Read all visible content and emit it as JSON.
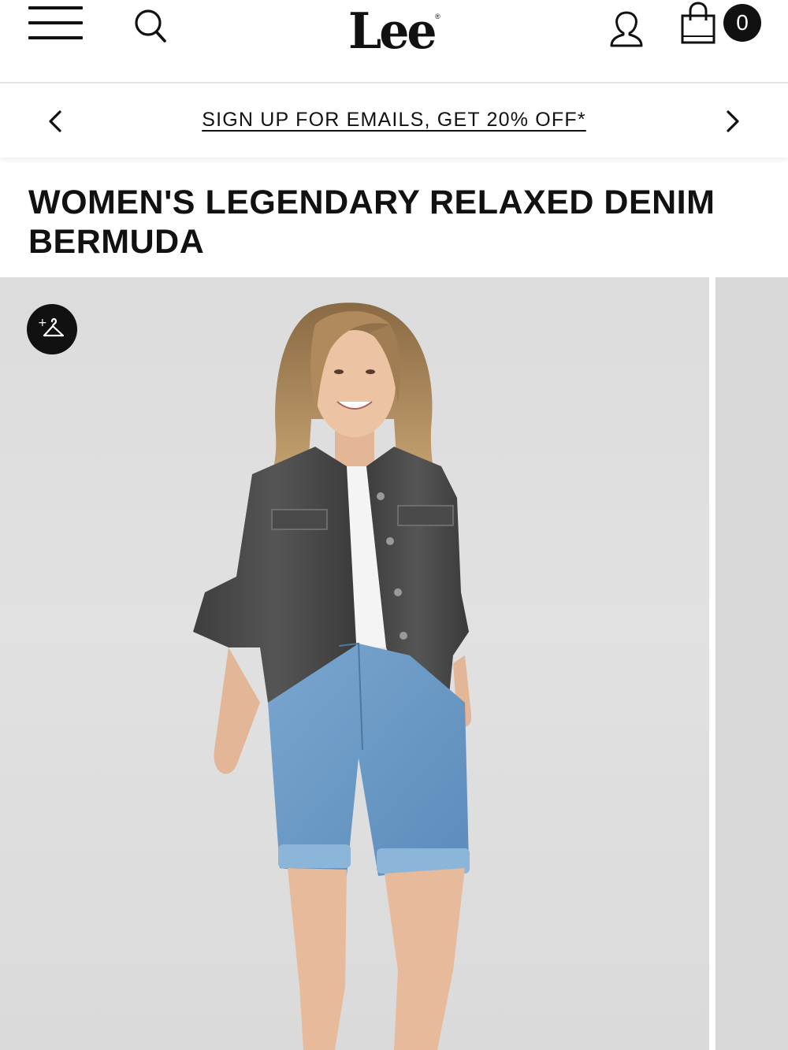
{
  "header": {
    "menu_icon": "hamburger-menu-icon",
    "search_icon": "search-icon",
    "logo_text": "Lee",
    "logo_mark": "®",
    "account_icon": "user-account-icon",
    "cart_icon": "shopping-bag-icon",
    "cart_count": "0"
  },
  "promo": {
    "prev_icon": "chevron-left-icon",
    "next_icon": "chevron-right-icon",
    "text": "SIGN UP FOR EMAILS, GET 20% OFF*"
  },
  "product": {
    "title": "WOMEN'S LEGENDARY RELAXED DENIM BERMUDA"
  },
  "gallery": {
    "wishlist_icon": "add-to-wishlist-hanger-icon",
    "image_bg": "#dedede"
  },
  "colors": {
    "text": "#111111",
    "background": "#ffffff",
    "image_background": "#dedede"
  }
}
